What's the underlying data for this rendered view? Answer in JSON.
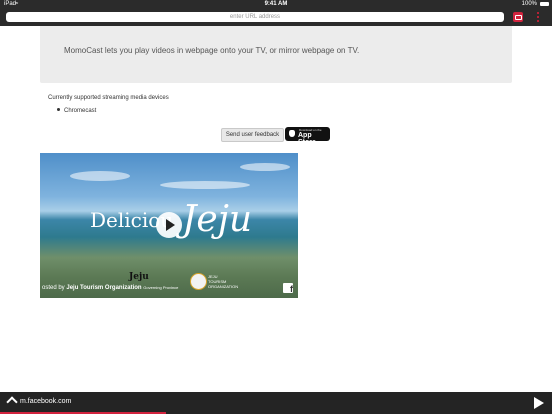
{
  "status_bar": {
    "carrier": "iPad",
    "time": "9:41 AM",
    "battery": "100%"
  },
  "browser": {
    "url_placeholder": "enter URL address",
    "cast_button_icon": "cast-icon",
    "menu_icon": "more-vertical-icon",
    "accent_color": "#d2233e"
  },
  "info": {
    "text": "MomoCast lets you play videos in webpage onto your TV, or mirror webpage on TV."
  },
  "devices": {
    "label": "Currently supported streaming media devices",
    "items": [
      "Chromecast"
    ]
  },
  "actions": {
    "feedback": "Send user feedback",
    "appstore_small": "Download on the",
    "appstore_big": "App Store"
  },
  "video": {
    "title_part1": "Deliciou",
    "title_part2": "Jeju",
    "small_logo": "Jeju",
    "org_logo_line1": "JEJU",
    "org_logo_line2": "TOURISM",
    "org_logo_line3": "ORGANIZATION",
    "caption_prefix": "osted by",
    "caption_author": "Jeju Tourism Organization",
    "caption_suffix": "Governing Province",
    "fb_icon": "facebook-icon"
  },
  "bottom_bar": {
    "url": "m.facebook.com",
    "progress_fraction": 0.3
  }
}
